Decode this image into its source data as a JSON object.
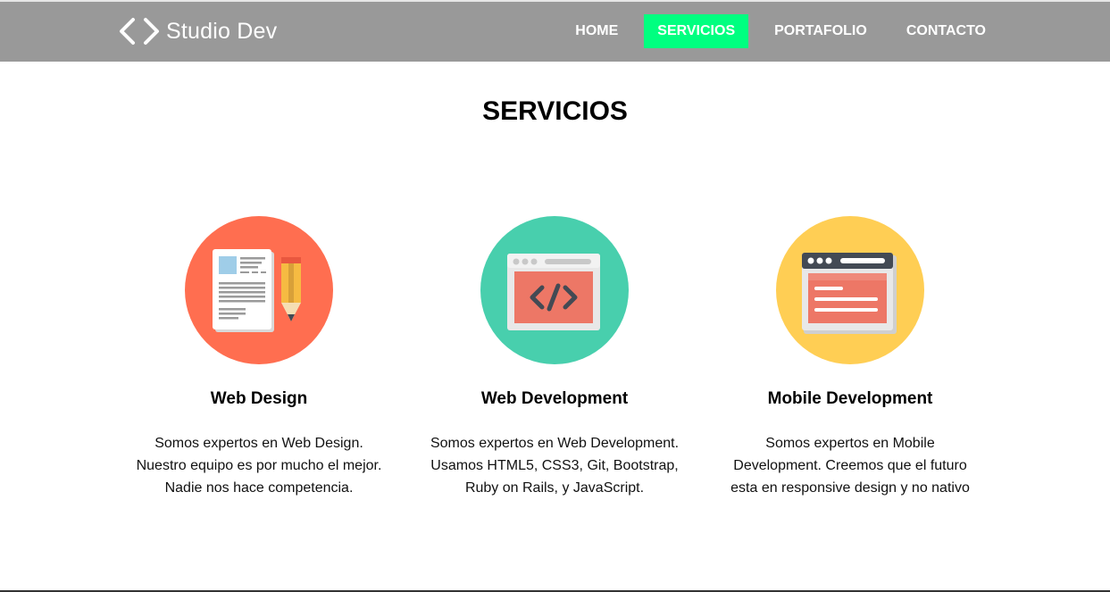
{
  "brand": {
    "name": "Studio Dev",
    "icon": "code-brackets-icon"
  },
  "nav": {
    "items": [
      {
        "label": "HOME",
        "active": false
      },
      {
        "label": "SERVICIOS",
        "active": true
      },
      {
        "label": "PORTAFOLIO",
        "active": false
      },
      {
        "label": "CONTACTO",
        "active": false
      }
    ],
    "active_color": "#00ff80",
    "bar_color": "#999999"
  },
  "page": {
    "title": "SERVICIOS"
  },
  "services": [
    {
      "title": "Web Design",
      "description": "Somos expertos en Web Design. Nuestro equipo es por mucho el mejor. Nadie nos hace competencia.",
      "icon": "document-pencil-icon",
      "color": "#ff6e50"
    },
    {
      "title": "Web Development",
      "description": "Somos expertos en Web Development. Usamos HTML5, CSS3, Git, Bootstrap, Ruby on Rails, y JavaScript.",
      "icon": "code-window-icon",
      "color": "#48cfad"
    },
    {
      "title": "Mobile Development",
      "description": "Somos expertos en Mobile Development. Creemos que el futuro esta en responsive design y no nativo",
      "icon": "browser-window-icon",
      "color": "#ffce54"
    }
  ]
}
